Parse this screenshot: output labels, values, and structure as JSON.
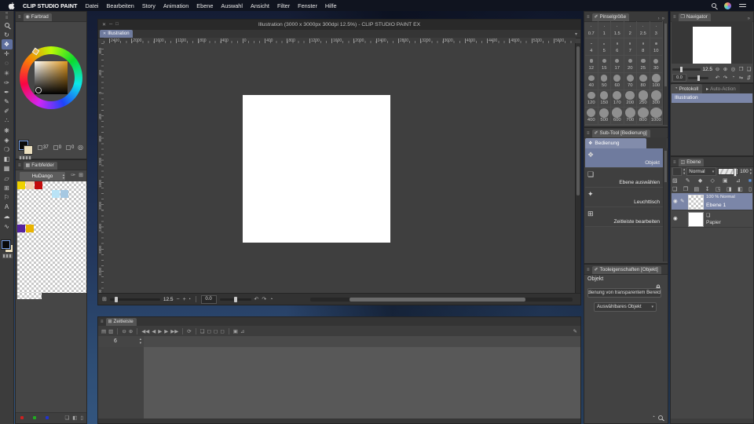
{
  "menubar": {
    "app_name": "CLIP STUDIO PAINT",
    "items": [
      "Datei",
      "Bearbeiten",
      "Story",
      "Animation",
      "Ebene",
      "Auswahl",
      "Ansicht",
      "Filter",
      "Fenster",
      "Hilfe"
    ]
  },
  "toolstrip": {
    "tools": [
      {
        "name": "zoom-tool",
        "glyph": "MAG"
      },
      {
        "name": "rotate-tool",
        "glyph": "↻"
      },
      {
        "name": "operation-tool",
        "glyph": "❖",
        "selected": true
      },
      {
        "name": "move-tool",
        "glyph": "✛"
      },
      {
        "name": "selection-tool",
        "glyph": "◌"
      },
      {
        "name": "auto-select-tool",
        "glyph": "✳"
      },
      {
        "name": "eyedropper-tool",
        "glyph": "✑"
      },
      {
        "name": "pen-tool",
        "glyph": "✒"
      },
      {
        "name": "pencil-tool",
        "glyph": "✎"
      },
      {
        "name": "brush-tool",
        "glyph": "✐"
      },
      {
        "name": "airbrush-tool",
        "glyph": "∴"
      },
      {
        "name": "decoration-tool",
        "glyph": "❋"
      },
      {
        "name": "eraser-tool",
        "glyph": "◈"
      },
      {
        "name": "blend-tool",
        "glyph": "❍"
      },
      {
        "name": "fill-tool",
        "glyph": "◧"
      },
      {
        "name": "gradient-tool",
        "glyph": "▦"
      },
      {
        "name": "figure-tool",
        "glyph": "▱"
      },
      {
        "name": "frame-border-tool",
        "glyph": "⊞"
      },
      {
        "name": "ruler-tool",
        "glyph": "⚐"
      },
      {
        "name": "text-tool",
        "glyph": "A"
      },
      {
        "name": "balloon-tool",
        "glyph": "☁"
      },
      {
        "name": "correct-line-tool",
        "glyph": "∿"
      }
    ]
  },
  "color_wheel": {
    "tab": "Farbrad",
    "hsv": [
      "37",
      "0",
      "0"
    ]
  },
  "swatch_panel": {
    "tab": "Farbfelder",
    "set_name": "HuDango",
    "cells": [
      {
        "row": 0,
        "col": 0,
        "color": "#f0d200"
      },
      {
        "row": 0,
        "col": 1,
        "color": "#f2cdae"
      },
      {
        "row": 0,
        "col": 2,
        "color": "#c30b0b"
      },
      {
        "row": 1,
        "col": 4,
        "color": "#b9e3f6"
      },
      {
        "row": 1,
        "col": 5,
        "color": "#a6c8e2"
      },
      {
        "row": 5,
        "col": 0,
        "color": "#55239f"
      },
      {
        "row": 5,
        "col": 1,
        "color": "#e9b300"
      }
    ]
  },
  "canvas_window": {
    "title": "Illustration (3000 x 3000px 300dpi 12.5%)  - CLIP STUDIO PAINT EX",
    "tab_label": "Illustration",
    "ruler_h": [
      "2400",
      "2000",
      "1600",
      "1200",
      "800",
      "400",
      "0",
      "400",
      "800",
      "1200",
      "1600",
      "2000",
      "2400",
      "2800",
      "3200",
      "3600",
      "4000",
      "4400",
      "4800",
      "5200",
      "5600"
    ],
    "ruler_v": [
      "800",
      "400",
      "0",
      "400",
      "800",
      "1200",
      "1600",
      "2000",
      "2400",
      "2800",
      "3200",
      "3600"
    ],
    "zoom_value": "12.5",
    "rotation_value": "0.0"
  },
  "brush_panel": {
    "tab": "Pinselgröße",
    "sizes": [
      "0.7",
      "1",
      "1.5",
      "2",
      "2.5",
      "3",
      "4",
      "5",
      "6",
      "7",
      "8",
      "10",
      "12",
      "15",
      "17",
      "20",
      "25",
      "30",
      "40",
      "50",
      "60",
      "70",
      "80",
      "100",
      "120",
      "150",
      "170",
      "200",
      "250",
      "300",
      "400",
      "500",
      "600",
      "700",
      "800",
      "1000"
    ]
  },
  "subtool_panel": {
    "tab": "Sub-Tool [Bedienung]",
    "group_tab": "Bedienung",
    "group_icon": "❖",
    "items": [
      {
        "label": "Objekt",
        "glyph": "❖",
        "icon": "object-icon",
        "selected": true
      },
      {
        "label": "Ebene auswählen",
        "glyph": "❏",
        "icon": "select-layer-icon",
        "selected": false
      },
      {
        "label": "Leuchttisch",
        "glyph": "✦",
        "icon": "light-table-icon",
        "selected": false
      },
      {
        "label": "Zeitleiste bearbeiten",
        "glyph": "⊞",
        "icon": "edit-timeline-icon",
        "selected": false
      }
    ]
  },
  "tool_props": {
    "tab": "Tooleigenschaften [Objekt]",
    "heading": "Objekt",
    "dropdown_transparent": "Bedienung von transparentem Bereich",
    "dropdown_selectable": "Auswählbares Objekt"
  },
  "navigator": {
    "tab": "Navigator",
    "zoom_value": "12.5",
    "rotation_value": "0.0",
    "icons_row1": [
      {
        "name": "zoom-out-icon",
        "g": "⊖"
      },
      {
        "name": "zoom-in-icon",
        "g": "⊕"
      },
      {
        "name": "zoom-100-icon",
        "g": "◎"
      },
      {
        "name": "fit-screen-icon",
        "g": "❐"
      },
      {
        "name": "actual-size-icon",
        "g": "❏"
      }
    ],
    "icons_row2": [
      {
        "name": "rotate-ccw-icon",
        "g": "↶"
      },
      {
        "name": "rotate-cw-icon",
        "g": "↷"
      },
      {
        "name": "reset-rotation-icon",
        "g": "◔"
      },
      {
        "name": "flip-horizontal-icon",
        "g": "⇋"
      },
      {
        "name": "flip-vertical-icon",
        "g": "⇵"
      }
    ]
  },
  "history": {
    "tab_active": "Protokoll",
    "tab_inactive": "Auto-Action",
    "items": [
      "Illustration"
    ]
  },
  "layers_panel": {
    "tab": "Ebene",
    "blend_mode": "Normal",
    "opacity": "100",
    "icons_row1": [
      {
        "name": "thumbnail-icon",
        "g": "▨"
      },
      {
        "name": "edit-layer-icon",
        "g": "✎"
      },
      {
        "name": "lock-layer-icon",
        "g": "◆"
      },
      {
        "name": "lock-alpha-icon",
        "g": "◇"
      },
      {
        "name": "mask-icon",
        "g": "▣"
      },
      {
        "name": "ruler-layer-icon",
        "g": "⊿"
      },
      {
        "name": "layer-color-icon",
        "g": "■",
        "color": "#5b8fd8"
      }
    ],
    "icons_row2": [
      {
        "name": "new-layer-icon",
        "g": "❏"
      },
      {
        "name": "new-vector-layer-icon",
        "g": "❐"
      },
      {
        "name": "new-folder-icon",
        "g": "▤"
      },
      {
        "name": "merge-down-icon",
        "g": "↧"
      },
      {
        "name": "transfer-icon",
        "g": "◳"
      },
      {
        "name": "combine-icon",
        "g": "◨"
      },
      {
        "name": "mask2-icon",
        "g": "◧"
      },
      {
        "name": "delete-layer-icon",
        "g": "▯"
      }
    ],
    "layers": [
      {
        "name": "Ebene 1",
        "info": "100 % Normal",
        "thumb": "checker",
        "selected": true
      },
      {
        "name": "Papier",
        "thumb": "white",
        "selected": false
      }
    ]
  },
  "timeline": {
    "tab": "Zeitleiste",
    "frame_value": "6",
    "toolbar_icons": [
      {
        "name": "timeline-list-icon",
        "g": "▤"
      },
      {
        "name": "timeline-settings-icon",
        "g": "▥"
      },
      {
        "name": "sep",
        "g": ""
      },
      {
        "name": "zoom-out-icon",
        "g": "⊖"
      },
      {
        "name": "zoom-in-icon",
        "g": "⊕"
      },
      {
        "name": "sep",
        "g": ""
      },
      {
        "name": "first-frame-icon",
        "g": "◀◀"
      },
      {
        "name": "prev-frame-icon",
        "g": "◀"
      },
      {
        "name": "play-icon",
        "g": "▶"
      },
      {
        "name": "next-frame-icon",
        "g": "▶"
      },
      {
        "name": "last-frame-icon",
        "g": "▶▶"
      },
      {
        "name": "sep",
        "g": ""
      },
      {
        "name": "loop-icon",
        "g": "⟳"
      },
      {
        "name": "sep",
        "g": ""
      },
      {
        "name": "onion-skin-icon",
        "g": "❏"
      },
      {
        "name": "cel-display-icon",
        "g": "◻"
      },
      {
        "name": "cel-edit-icon",
        "g": "◻"
      },
      {
        "name": "cel-batch-icon",
        "g": "◻"
      },
      {
        "name": "sep",
        "g": ""
      },
      {
        "name": "keyframe-icon",
        "g": "▣"
      },
      {
        "name": "graph-editor-icon",
        "g": "⊿"
      },
      {
        "name": "draw-icon",
        "g": "✎"
      }
    ]
  },
  "icons": {
    "menu": "≡",
    "collapse": "«",
    "back": "‹",
    "close": "✕",
    "minimize": "─",
    "maximize": "□",
    "chevron_down": "▾",
    "chevron_up": "▴",
    "nav_grid": "⊞",
    "minus": "−",
    "plus": "+",
    "square": "▪",
    "rotate_ccw": "↶",
    "rotate_cw": "↷",
    "rotate_reset": "◔",
    "clock": "◔",
    "register": "✑",
    "new_page": "⊞",
    "page": "❏",
    "bucket": "◧",
    "trash": "▯",
    "circle": "◎",
    "collapse_right": "›",
    "collapse_all": "»"
  },
  "panel_icons": {
    "farbrad": "◉",
    "farbfelder": "▦",
    "pinselgroesse": "✐",
    "subtool": "✐",
    "tooleigenschaften": "✐",
    "navigator": "❐",
    "protokoll": "◔",
    "auto_action": "▸",
    "ebene": "◫",
    "zeitleiste": "⊞"
  },
  "colors": {
    "selection_blue": "#7b86a8",
    "tab_blue": "#6f7b9e",
    "menubar_bg": "#10141f",
    "rgb_dots": [
      "#cc2222",
      "#22aa22",
      "#2233cc"
    ]
  }
}
